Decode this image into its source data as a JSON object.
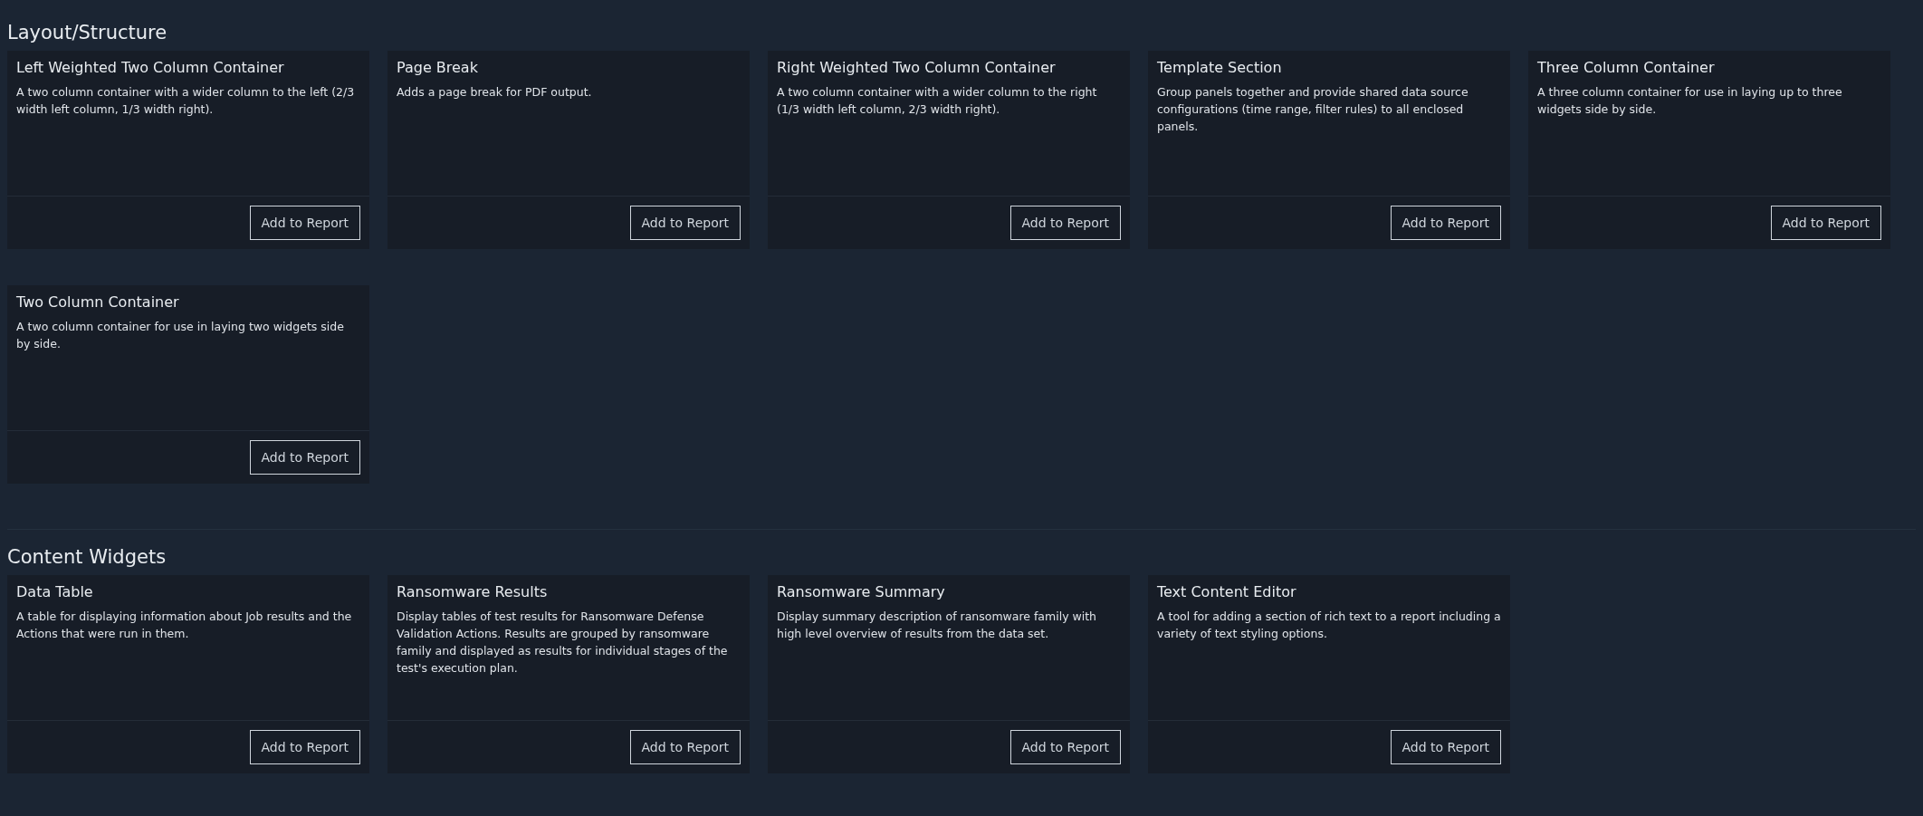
{
  "sections": [
    {
      "title": "Layout/Structure",
      "widgets": [
        {
          "title": "Left Weighted Two Column Container",
          "description": "A two column container with a wider column to the left (2/3 width left column, 1/3 width right).",
          "button": "Add to Report"
        },
        {
          "title": "Page Break",
          "description": "Adds a page break for PDF output.",
          "button": "Add to Report"
        },
        {
          "title": "Right Weighted Two Column Container",
          "description": "A two column container with a wider column to the right (1/3 width left column, 2/3 width right).",
          "button": "Add to Report"
        },
        {
          "title": "Template Section",
          "description": "Group panels together and provide shared data source configurations (time range, filter rules) to all enclosed panels.",
          "button": "Add to Report"
        },
        {
          "title": "Three Column Container",
          "description": "A three column container for use in laying up to three widgets side by side.",
          "button": "Add to Report"
        },
        {
          "title": "Two Column Container",
          "description": "A two column container for use in laying two widgets side by side.",
          "button": "Add to Report"
        }
      ]
    },
    {
      "title": "Content Widgets",
      "widgets": [
        {
          "title": "Data Table",
          "description": "A table for displaying information about Job results and the Actions that were run in them.",
          "button": "Add to Report"
        },
        {
          "title": "Ransomware Results",
          "description": "Display tables of test results for Ransomware Defense Validation Actions. Results are grouped by ransomware family and displayed as results for individual stages of the test's execution plan.",
          "button": "Add to Report"
        },
        {
          "title": "Ransomware Summary",
          "description": "Display summary description of ransomware family with high level overview of results from the data set.",
          "button": "Add to Report"
        },
        {
          "title": "Text Content Editor",
          "description": "A tool for adding a section of rich text to a report including a variety of text styling options.",
          "button": "Add to Report"
        }
      ]
    }
  ]
}
